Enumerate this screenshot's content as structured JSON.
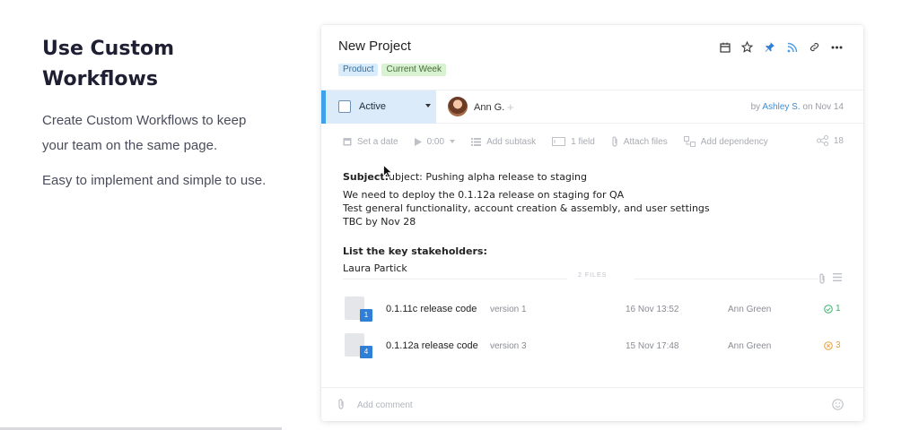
{
  "marketing": {
    "heading_line1": "Use Custom",
    "heading_line2": "Workflows",
    "lead_line1": "Create Custom Workflows to keep",
    "lead_line2": "your team on the same page.",
    "second": "Easy to implement and simple to use."
  },
  "card": {
    "title": "New Project",
    "tags": [
      "Product",
      "Current Week"
    ],
    "header_icons": [
      "calendar-icon",
      "star-icon",
      "pin-icon",
      "rss-icon",
      "link-icon",
      "more-icon"
    ],
    "status": {
      "label": "Active"
    },
    "assignee": {
      "name": "Ann G.",
      "add": "+"
    },
    "byline": {
      "prefix": "by",
      "author": "Ashley S.",
      "suffix": "on Nov 14"
    },
    "toolbar": {
      "set_date": "Set a date",
      "timer": "0:00",
      "add_subtask": "Add subtask",
      "field": "1 field",
      "attach": "Attach files",
      "dependency": "Add dependency",
      "count": "18"
    },
    "body": {
      "subject_label": "Subject:",
      "subject_text": "ubject: Pushing alpha release to staging",
      "lines": [
        "We need to deploy the 0.1.12a release on staging for QA",
        "Test general functionality, account creation & assembly, and user settings",
        "TBC by Nov 28"
      ],
      "stakeholders_heading": "List the key stakeholders:",
      "stakeholder": "Laura Partick"
    },
    "files_label": "2 FILES",
    "files": [
      {
        "badge": "1",
        "name": "0.1.11c release code",
        "version": "version 1",
        "date": "16 Nov 13:52",
        "owner": "Ann Green",
        "status_count": "1",
        "status": "ok"
      },
      {
        "badge": "4",
        "name": "0.1.12a release code",
        "version": "version 3",
        "date": "15 Nov 17:48",
        "owner": "Ann Green",
        "status_count": "3",
        "status": "warn"
      }
    ],
    "comment": {
      "placeholder": "Add comment"
    }
  },
  "colors": {
    "accent": "#3fa0ec",
    "status_bg": "#dcebfa",
    "link": "#3a8fd4",
    "ok": "#3bb06a",
    "warn": "#e7a13a"
  }
}
